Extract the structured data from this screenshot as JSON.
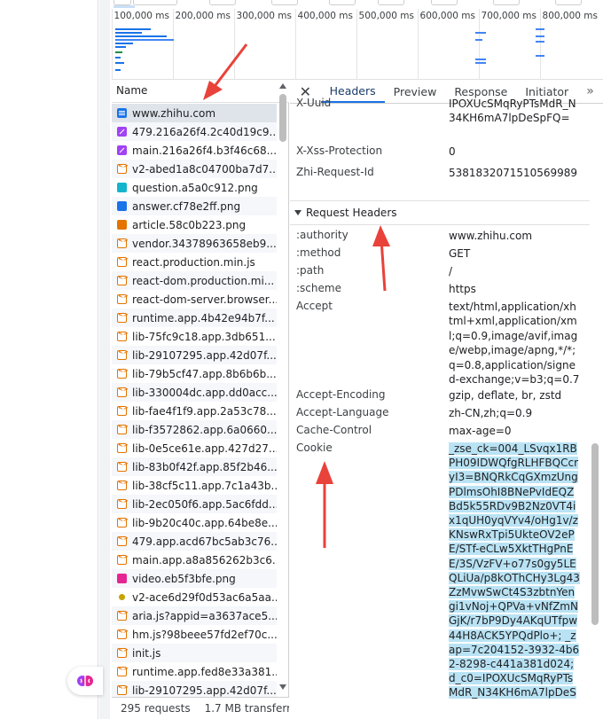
{
  "timeline": {
    "ticks": [
      "100,000 ms",
      "200,000 ms",
      "300,000 ms",
      "400,000 ms",
      "500,000 ms",
      "600,000 ms",
      "700,000 ms",
      "800,000 ms"
    ]
  },
  "list": {
    "column_header": "Name",
    "rows": [
      {
        "name": "www.zhihu.com",
        "icon": "document-icon",
        "selected": true
      },
      {
        "name": "479.216a26f4.2c40d19c9...",
        "icon": "stylesheet-icon"
      },
      {
        "name": "main.216a26f4.b3f46c68...",
        "icon": "stylesheet-icon"
      },
      {
        "name": "v2-abed1a8c04700ba7d7...",
        "icon": "script-icon"
      },
      {
        "name": "question.a5a0c912.png",
        "icon": "image-icon"
      },
      {
        "name": "answer.cf78e2ff.png",
        "icon": "image-icon"
      },
      {
        "name": "article.58c0b223.png",
        "icon": "image-icon"
      },
      {
        "name": "vendor.34378963658eb9...",
        "icon": "script-icon"
      },
      {
        "name": "react.production.min.js",
        "icon": "script-icon"
      },
      {
        "name": "react-dom.production.mi...",
        "icon": "script-icon"
      },
      {
        "name": "react-dom-server.browser...",
        "icon": "script-icon"
      },
      {
        "name": "runtime.app.4b42e94b7f...",
        "icon": "script-icon"
      },
      {
        "name": "lib-75fc9c18.app.3db651...",
        "icon": "script-icon"
      },
      {
        "name": "lib-29107295.app.42d07f...",
        "icon": "script-icon"
      },
      {
        "name": "lib-79b5cf47.app.8b6b6b...",
        "icon": "script-icon"
      },
      {
        "name": "lib-330004dc.app.dd0acc...",
        "icon": "script-icon"
      },
      {
        "name": "lib-fae4f1f9.app.2a53c78...",
        "icon": "script-icon"
      },
      {
        "name": "lib-f3572862.app.6a0660...",
        "icon": "script-icon"
      },
      {
        "name": "lib-0e5ce61e.app.427d27...",
        "icon": "script-icon"
      },
      {
        "name": "lib-83b0f42f.app.85f2b46...",
        "icon": "script-icon"
      },
      {
        "name": "lib-38cf5c11.app.7c1a43b...",
        "icon": "script-icon"
      },
      {
        "name": "lib-2ec050f6.app.5ac6fdd...",
        "icon": "script-icon"
      },
      {
        "name": "lib-9b20c40c.app.64be8e...",
        "icon": "script-icon"
      },
      {
        "name": "479.app.acd67bc5ab3c76...",
        "icon": "script-icon"
      },
      {
        "name": "main.app.a8a856262b3c6...",
        "icon": "script-icon"
      },
      {
        "name": "video.eb5f3bfe.png",
        "icon": "image-icon"
      },
      {
        "name": "v2-ace6d29f0d53ac6a5aa...",
        "icon": "image-icon"
      },
      {
        "name": "aria.js?appid=a3637ace5...",
        "icon": "script-icon"
      },
      {
        "name": "hm.js?98beee57fd2ef70c...",
        "icon": "script-icon"
      },
      {
        "name": "init.js",
        "icon": "script-icon"
      },
      {
        "name": "runtime.app.fed8e33a381...",
        "icon": "script-icon"
      },
      {
        "name": "lib-29107295.app.42d07f...",
        "icon": "script-icon"
      }
    ],
    "status": {
      "requests": "295 requests",
      "transferred": "1.7 MB transferre"
    }
  },
  "detail": {
    "tabs": [
      "Headers",
      "Preview",
      "Response",
      "Initiator"
    ],
    "active_tab": "Headers",
    "response_headers_tail": [
      {
        "key": "X-Uuid",
        "value": "IPOXUcSMqRyPTsMdR_N34KH6mA7lpDeSpFQ="
      },
      {
        "key": "X-Xss-Protection",
        "value": "0"
      },
      {
        "key": "Zhi-Request-Id",
        "value": "5381832071510569989"
      }
    ],
    "request_headers_title": "Request Headers",
    "request_headers": [
      {
        "key": ":authority",
        "value": "www.zhihu.com"
      },
      {
        "key": ":method",
        "value": "GET"
      },
      {
        "key": ":path",
        "value": "/"
      },
      {
        "key": ":scheme",
        "value": "https"
      },
      {
        "key": "Accept",
        "value": "text/html,application/xhtml+xml,application/xml;q=0.9,image/avif,image/webp,image/apng,*/*;q=0.8,application/signed-exchange;v=b3;q=0.7"
      },
      {
        "key": "Accept-Encoding",
        "value": "gzip, deflate, br, zstd"
      },
      {
        "key": "Accept-Language",
        "value": "zh-CN,zh;q=0.9"
      },
      {
        "key": "Cache-Control",
        "value": "max-age=0"
      }
    ],
    "cookie_key": "Cookie",
    "cookie_value": "_zse_ck=004_LSvqx1RBPH09IDWQfgRLHFBQCcryI3=BNQRkCqGXmzUngPDlmsOhI8BNePvIdEQZBd5k55RDv9B2Nz0VT4ix1qUH0yqVYv4/oHg1v/zKNswRxTpi5UkteOV2ePE/STf-eCLw5XktTHgPnEE/3S/VzFV+o77s0gy5LEQLiUa/p8kOThCHy3Lg43ZzMvwSwCt4S3zbtnYengi1vNoj+QPVa+vNfZmNGjK/r7bP9Dy4AKqUTfpw44H8ACK5YPQdPlo+; _zap=7c204152-3932-4b62-8298-c441a381d024; d_c0=IPOXUcSMqRyPTsMdR_N34KH6mA7lpDeS"
  },
  "colors": {
    "selected_row": "#dfe4ea",
    "active_tab_underline": "#1a73e8",
    "cookie_highlight": "#b9e3f4",
    "annotation_arrow": "#e8423a"
  }
}
